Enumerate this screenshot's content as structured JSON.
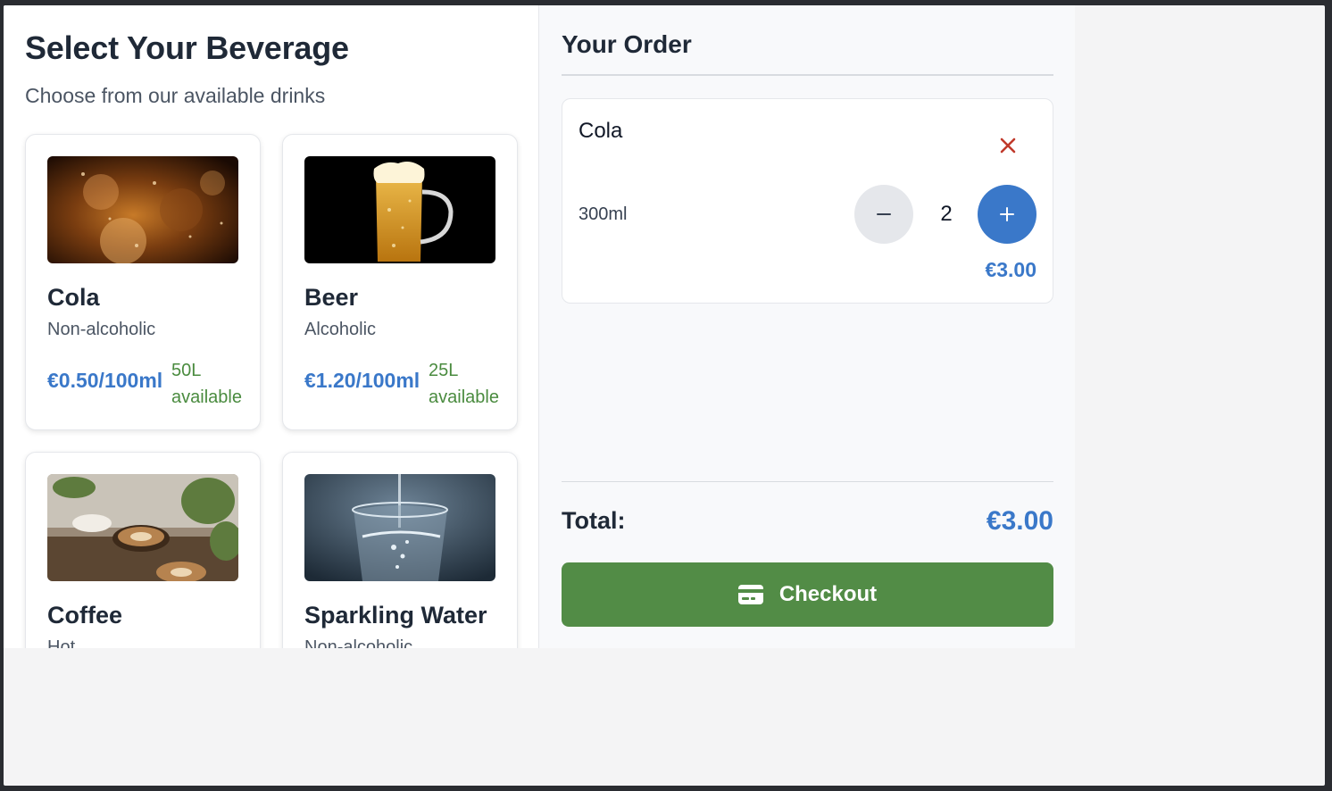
{
  "menu": {
    "title": "Select Your Beverage",
    "subtitle": "Choose from our available drinks",
    "beverages": [
      {
        "name": "Cola",
        "type": "Non-alcoholic",
        "price": "€0.50/100ml",
        "stock": "50L",
        "stock_suffix": "available",
        "image": "cola-glass-image"
      },
      {
        "name": "Beer",
        "type": "Alcoholic",
        "price": "€1.20/100ml",
        "stock": "25L",
        "stock_suffix": "available",
        "image": "beer-mug-image"
      },
      {
        "name": "Coffee",
        "type": "Hot",
        "price": "",
        "stock": "",
        "stock_suffix": "",
        "image": "coffee-cups-image"
      },
      {
        "name": "Sparkling Water",
        "type": "Non-alcoholic",
        "price": "",
        "stock": "",
        "stock_suffix": "",
        "image": "water-glass-image"
      }
    ]
  },
  "order": {
    "title": "Your Order",
    "items": [
      {
        "name": "Cola",
        "size": "300ml",
        "quantity": "2",
        "line_total": "€3.00",
        "minus_icon": "minus-icon",
        "plus_icon": "plus-icon",
        "remove_icon": "close-icon"
      }
    ],
    "total_label": "Total:",
    "total_value": "€3.00",
    "checkout_label": "Checkout",
    "checkout_icon": "credit-card-icon"
  },
  "colors": {
    "accent_blue": "#3a78c9",
    "success_green": "#528c46",
    "stock_green": "#4a8b3f",
    "remove_red": "#c0392b"
  }
}
